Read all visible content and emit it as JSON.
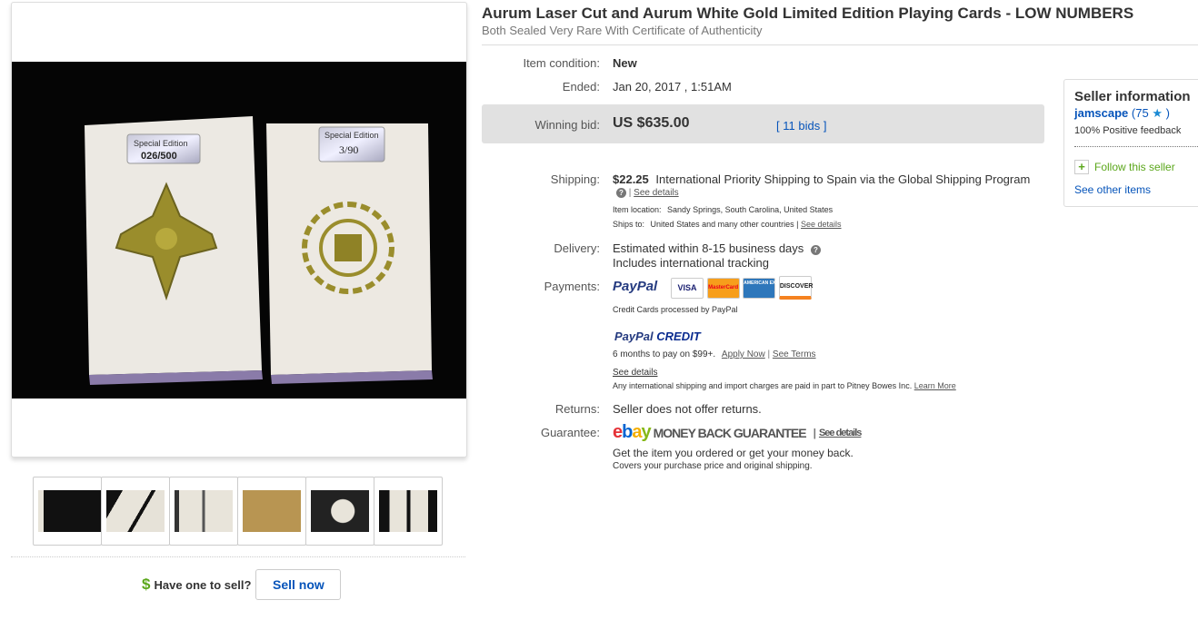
{
  "title": "Aurum Laser Cut and Aurum White Gold Limited Edition Playing Cards - LOW NUMBERS",
  "subtitle": "Both Sealed Very Rare With Certificate of Authenticity",
  "details": {
    "condition_label": "Item condition:",
    "condition_value": "New",
    "ended_label": "Ended:",
    "ended_value": "Jan 20, 2017 , 1:51AM",
    "bid_label": "Winning bid:",
    "bid_value": "US $635.00",
    "bids_link": "11 bids",
    "bids_open": "[",
    "bids_close": "]"
  },
  "shipping": {
    "label": "Shipping:",
    "price": "$22.25",
    "method": "International Priority Shipping to Spain  via the Global Shipping Program",
    "see_details": "See details",
    "location_label": "Item location:",
    "location": "Sandy Springs, South Carolina, United States",
    "ships_to_label": "Ships to:",
    "ships_to": "United States and many other countries |",
    "ships_to_link": "See details"
  },
  "delivery": {
    "label": "Delivery:",
    "line1": "Estimated within 8-15 business days",
    "line2": "Includes international tracking"
  },
  "payments": {
    "label": "Payments:",
    "paypal": "PayPal",
    "cards": [
      "VISA",
      "MasterCard",
      "AMERICAN EXPRESS",
      "DISCOVER"
    ],
    "cards_note": "Credit Cards processed by PayPal",
    "credit_logo_a": "PayPal",
    "credit_logo_b": "CREDIT",
    "credit_line": "6 months to pay on $99+.",
    "apply_now": "Apply Now",
    "see_terms": "See Terms",
    "see_details": "See details",
    "intl_note": "Any international shipping and import charges are paid in part to Pitney Bowes Inc.",
    "learn_more": "Learn More"
  },
  "returns": {
    "label": "Returns:",
    "value": "Seller does not offer returns."
  },
  "guarantee": {
    "label": "Guarantee:",
    "logo": "ebay",
    "text": "MONEY BACK GUARANTEE",
    "see_details": "See details",
    "line1": "Get the item you ordered or get your money back.",
    "line2": "Covers your purchase price and original shipping."
  },
  "seller": {
    "heading": "Seller information",
    "name": "jamscape",
    "score_open": "(75",
    "score_close": ")",
    "feedback": "100% Positive feedback",
    "follow": "Follow this seller",
    "see_other": "See other items"
  },
  "sell": {
    "dollar": "$",
    "prompt": "Have one to sell?",
    "button": "Sell now"
  },
  "photo": {
    "label_left": "Special Edition",
    "number_left": "026/500",
    "label_right": "Special Edition",
    "number_right": "3/90"
  },
  "colors": {
    "link": "#0654ba",
    "gold": "#9a8d2c",
    "bid_bg": "#e1e1e1",
    "paypal_dark": "#253b80",
    "paypal_light": "#179bd7"
  }
}
